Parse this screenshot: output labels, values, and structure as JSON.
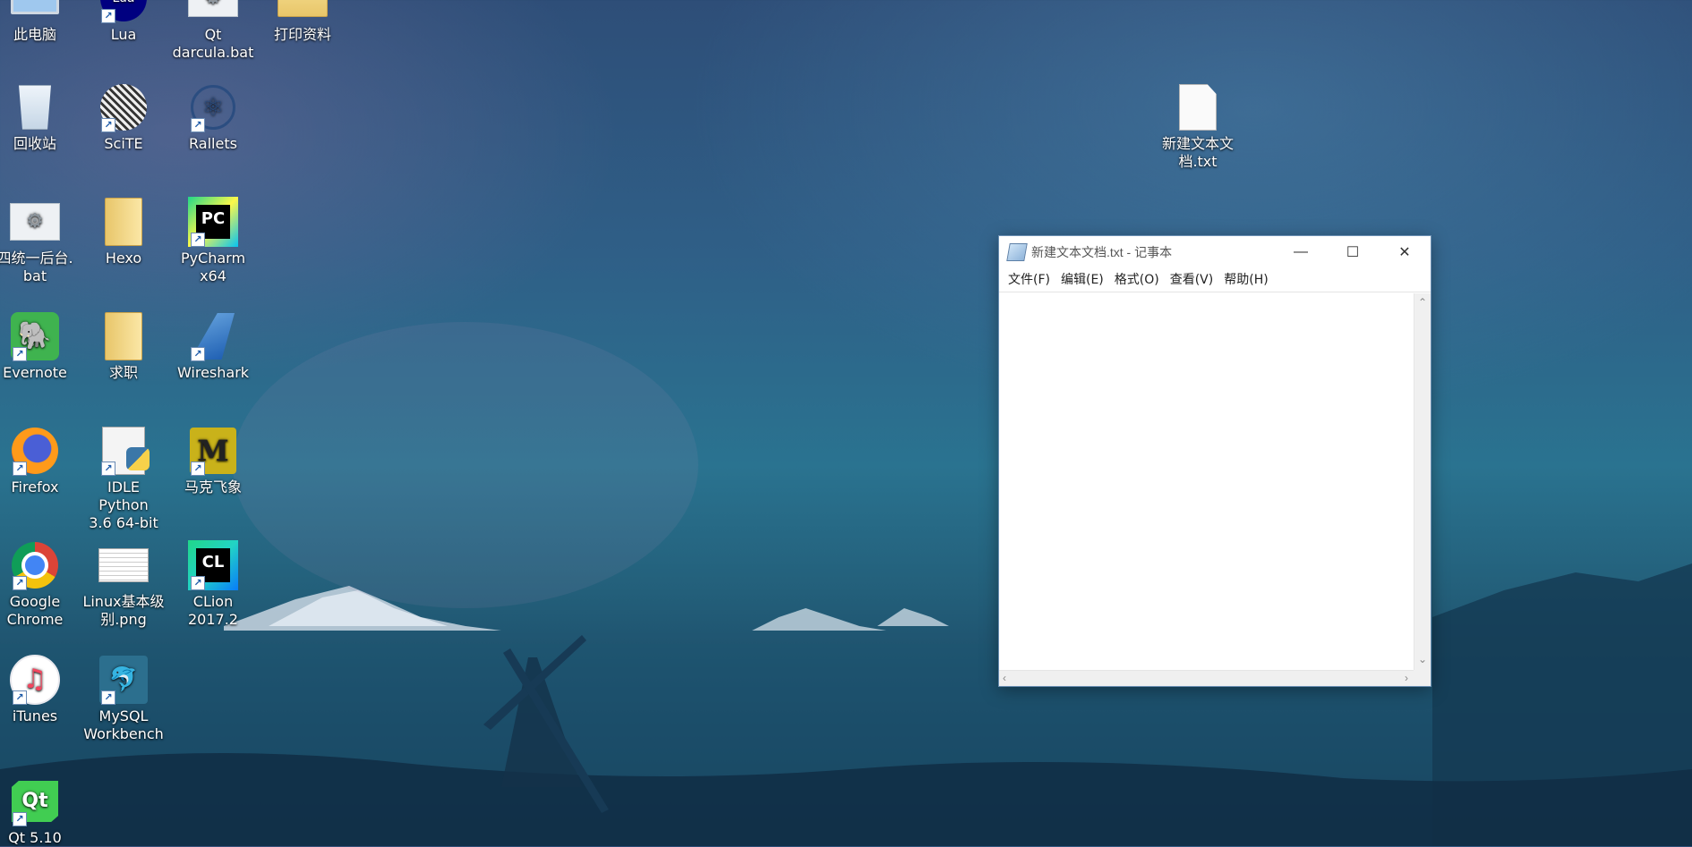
{
  "desktop": {
    "icons": [
      {
        "label": "此电脑"
      },
      {
        "label": "Lua"
      },
      {
        "label": "Qt\ndarcula.bat"
      },
      {
        "label": "打印资料"
      },
      {
        "label": "回收站"
      },
      {
        "label": "SciTE"
      },
      {
        "label": "Rallets"
      },
      {
        "label": "四统一后台.\nbat"
      },
      {
        "label": "Hexo"
      },
      {
        "label": "PyCharm\nx64"
      },
      {
        "label": "Evernote"
      },
      {
        "label": "求职"
      },
      {
        "label": "Wireshark"
      },
      {
        "label": "Firefox"
      },
      {
        "label": "IDLE Python\n3.6 64-bit"
      },
      {
        "label": "马克飞象"
      },
      {
        "label": "Google\nChrome"
      },
      {
        "label": "Linux基本级\n别.png"
      },
      {
        "label": "CLion\n2017.2"
      },
      {
        "label": "iTunes"
      },
      {
        "label": "MySQL\nWorkbench"
      },
      {
        "label": "Qt 5.10"
      },
      {
        "label": "新建文本文\n档.txt"
      }
    ],
    "icon_glyphs": {
      "lua": "Lua",
      "pycharm": "PC",
      "clion": "CL",
      "qt": "Qt",
      "markfly": "M"
    }
  },
  "notepad": {
    "title": "新建文本文档.txt - 记事本",
    "minimize": "—",
    "maximize": "☐",
    "close": "✕",
    "menus": [
      "文件(F)",
      "编辑(E)",
      "格式(O)",
      "查看(V)",
      "帮助(H)"
    ],
    "content": ""
  },
  "colors": {
    "wallpaper_sky": "#2e4e78",
    "wallpaper_sea": "#2a7390",
    "window_border": "#6b8fb3"
  }
}
